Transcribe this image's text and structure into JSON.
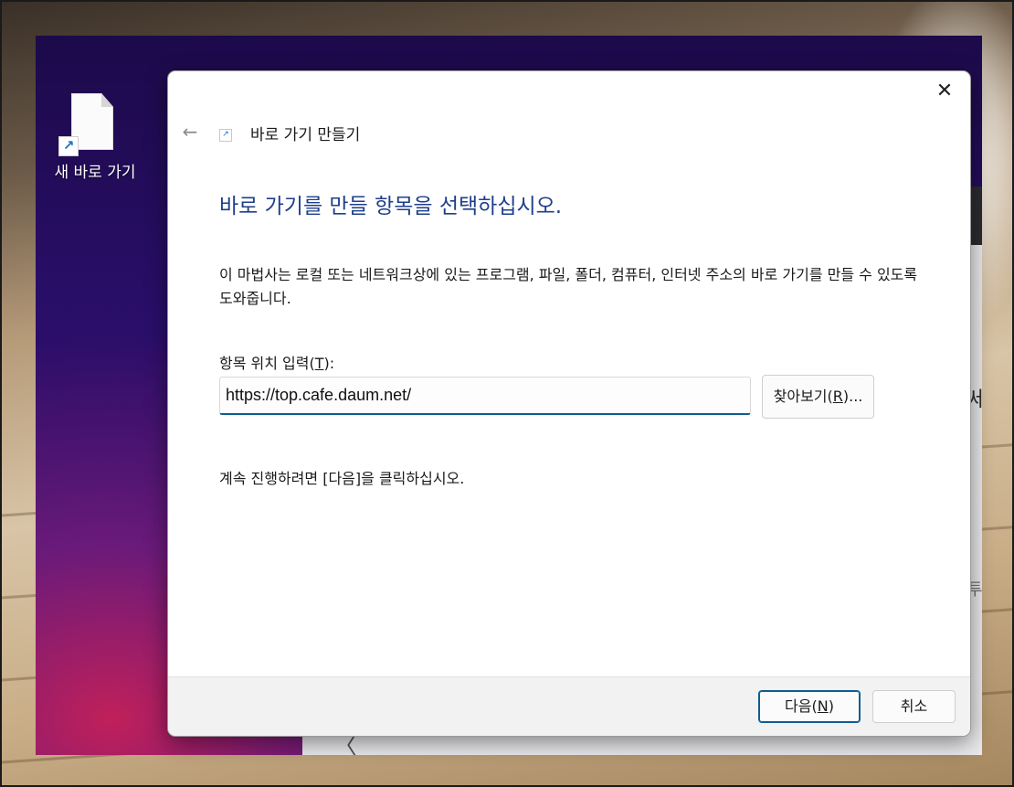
{
  "desktop": {
    "icon_label": "새 바로 가기",
    "background_chevron": "〈",
    "background_char_1": "세",
    "background_char_2": "투"
  },
  "dialog": {
    "close_glyph": "✕",
    "back_glyph": "←",
    "title": "바로 가기 만들기",
    "heading": "바로 가기를 만들 항목을 선택하십시오.",
    "description": "이 마법사는 로컬 또는 네트워크상에 있는 프로그램, 파일, 폴더, 컴퓨터, 인터넷 주소의 바로 가기를 만들 수 있도록 도와줍니다.",
    "field_label_prefix": "항목 위치 입력(",
    "field_label_key": "T",
    "field_label_suffix": "):",
    "location_value": "https://top.cafe.daum.net/",
    "browse_prefix": "찾아보기(",
    "browse_key": "R",
    "browse_suffix": ")...",
    "continue_text": "계속 진행하려면 [다음]을 클릭하십시오.",
    "next_prefix": "다음(",
    "next_key": "N",
    "next_suffix": ")",
    "cancel_label": "취소"
  },
  "colors": {
    "heading": "#1e3f8a",
    "input_accent": "#0e5c8e",
    "footer_bg": "#f2f2f2"
  },
  "icons": [
    "file-icon",
    "shortcut-arrow-icon",
    "back-arrow-icon",
    "close-icon"
  ]
}
